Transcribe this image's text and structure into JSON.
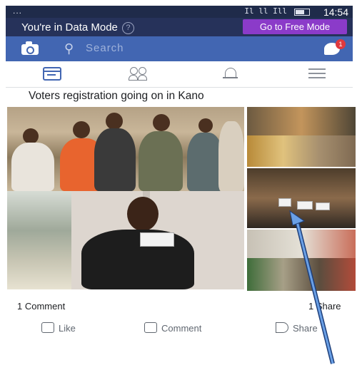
{
  "status_bar": {
    "dots": "...",
    "signal": "Il ll Ill",
    "time": "14:54"
  },
  "data_banner": {
    "text": "You're in Data Mode",
    "help": "?",
    "cta": "Go to Free Mode"
  },
  "search": {
    "placeholder": "Search"
  },
  "messenger_badge": "1",
  "post": {
    "title": "Voters registration going on in Kano",
    "comments_count": "1 Comment",
    "shares_count": "1 Share"
  },
  "actions": {
    "like": "Like",
    "comment": "Comment",
    "share": "Share"
  },
  "colors": {
    "header_blue": "#4266b2",
    "banner_dark": "#26325a",
    "free_mode_purple": "#8b3bc9",
    "arrow": "#5b8fd6"
  }
}
